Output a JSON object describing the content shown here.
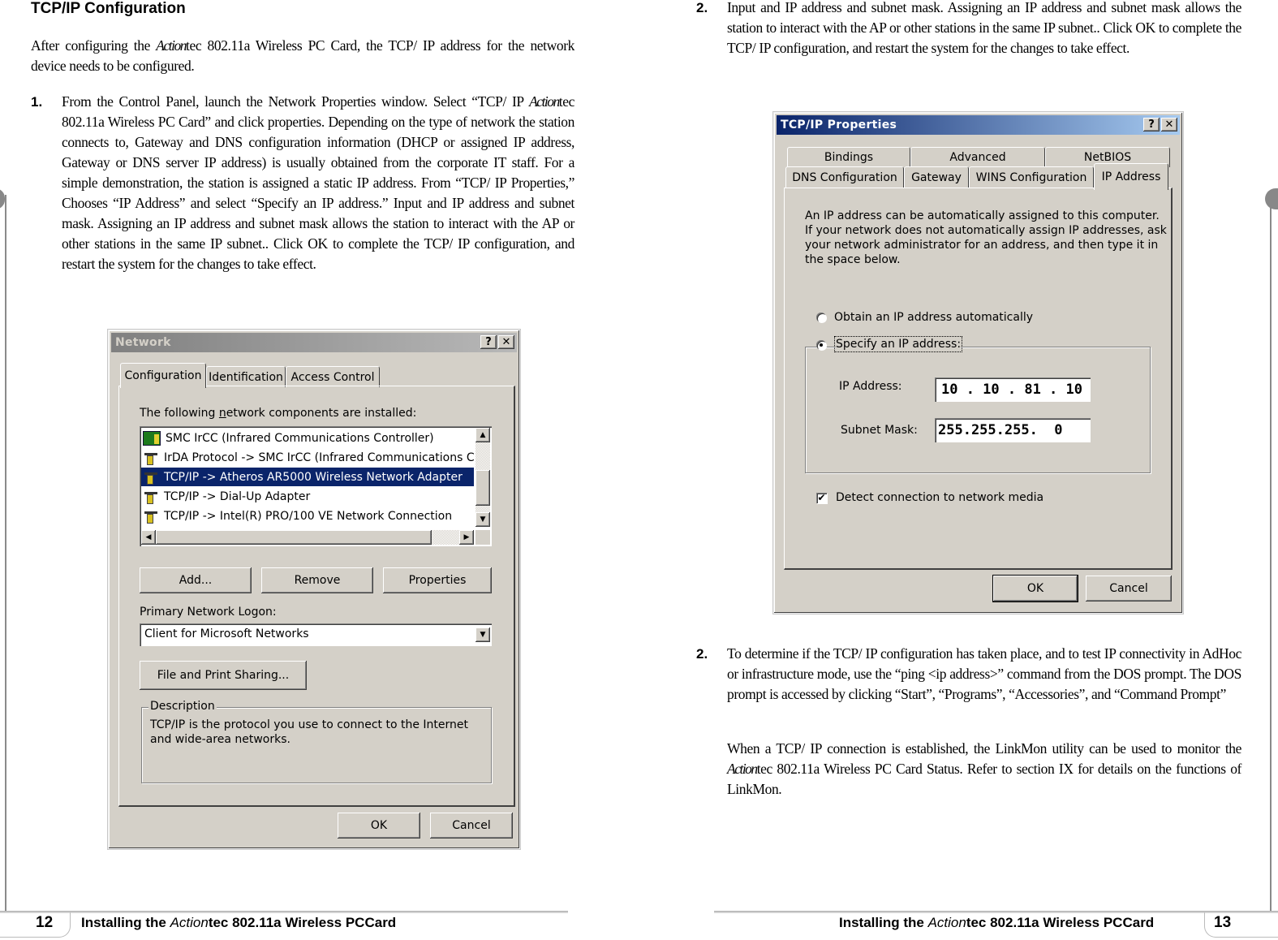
{
  "left_page": {
    "heading": "TCP/IP Configuration",
    "intro_pre": "After configuring the ",
    "brand": "Action",
    "intro_post": "tec 802.11a Wireless PC Card, the TCP/ IP address for the network device needs to be configured.",
    "step1_num": "1.",
    "step1_pre": "From the Control Panel, launch the Network Properties window. Select “TCP/ IP ",
    "step1_post": "tec 802.11a Wireless PC Card” and click properties. Depending on the type of network the station connects to, Gateway and DNS configuration information (DHCP or assigned IP address, Gateway or DNS server IP address) is usually obtained from the corporate IT staff. For a simple demonstration, the station is assigned a static IP address. From “TCP/ IP Properties,” Chooses “IP Address” and select “Specify an IP address.” Input and IP address and subnet mask. Assigning an IP address and subnet mask allows the station to interact with the AP or other stations in the same IP subnet.. Click OK to complete the TCP/ IP configuration, and restart the system for the changes to take effect.",
    "page_number": "12",
    "footer_pre": "Installing the ",
    "footer_brand": "Action",
    "footer_post": "tec 802.11a Wireless PCCard"
  },
  "network_dialog": {
    "title": "Network",
    "help_label": "?",
    "close_label": "✕",
    "tabs": [
      {
        "label": "Configuration",
        "active": true
      },
      {
        "label": "Identification",
        "active": false
      },
      {
        "label": "Access Control",
        "active": false
      }
    ],
    "components_label_pre": "The following ",
    "components_label_accel": "n",
    "components_label_post": "etwork components are installed:",
    "components": [
      {
        "label": "SMC IrCC (Infrared Communications Controller)",
        "icon": "network-adapter-icon",
        "selected": false
      },
      {
        "label": "IrDA Protocol -> SMC IrCC (Infrared Communications Controller)",
        "icon": "protocol-icon",
        "selected": false
      },
      {
        "label": "TCP/IP -> Atheros AR5000 Wireless Network Adapter",
        "icon": "protocol-icon",
        "selected": true
      },
      {
        "label": "TCP/IP -> Dial-Up Adapter",
        "icon": "protocol-icon",
        "selected": false
      },
      {
        "label": "TCP/IP -> Intel(R) PRO/100 VE Network Connection",
        "icon": "protocol-icon",
        "selected": false
      }
    ],
    "buttons": {
      "add": "Add...",
      "remove": "Remove",
      "properties": "Properties",
      "file_print": "File and Print Sharing...",
      "ok": "OK",
      "cancel": "Cancel"
    },
    "primary_logon_label": "Primary Network Logon:",
    "primary_logon_value": "Client for Microsoft Networks",
    "description_label": "Description",
    "description_text": "TCP/IP is the protocol you use to connect to the Internet and wide-area networks."
  },
  "right_page": {
    "step2a_num": "2.",
    "step2a_text": "Input and IP address and subnet mask. Assigning an IP address and subnet mask allows the station to interact with  the AP or other stations in the same IP subnet.. Click OK to complete the TCP/ IP configuration, and restart the system for the changes to take effect.",
    "step2b_num": "2.",
    "step2b_text": "To determine if the TCP/ IP configuration has taken place, and to test IP connectivity in AdHoc or infrastructure mode, use the “ping <ip address>” command from the DOS prompt. The DOS prompt is accessed by clicking “Start”,  “Programs”, “Accessories”, and “Command Prompt”",
    "step2c_pre": "When a TCP/ IP connection is established, the LinkMon utility can be used to monitor the ",
    "brand": "Action",
    "step2c_post": "tec 802.11a Wireless PC Card Status. Refer to section IX for details on the functions of LinkMon.",
    "page_number": "13",
    "footer_pre": "Installing the ",
    "footer_brand": "Action",
    "footer_post": "tec 802.11a Wireless PCCard"
  },
  "tcpip_dialog": {
    "title": "TCP/IP Properties",
    "help_label": "?",
    "close_label": "✕",
    "tabs_back": [
      {
        "label": "Bindings"
      },
      {
        "label": "Advanced"
      },
      {
        "label": "NetBIOS"
      }
    ],
    "tabs_front": [
      {
        "label": "DNS Configuration",
        "active": false
      },
      {
        "label": "Gateway",
        "active": false
      },
      {
        "label": "WINS Configuration",
        "active": false
      },
      {
        "label": "IP Address",
        "active": true
      }
    ],
    "info_text": "An IP address can be automatically assigned to this computer. If your network does not automatically assign IP addresses, ask your network administrator for an address, and then type it in the space below.",
    "info_lines": [
      "An IP address can be automatically assigned to this computer.",
      "If your network does not automatically assign IP addresses, ask",
      "your network administrator for an address, and then type it in",
      "the space below."
    ],
    "radio_obtain": {
      "label": "Obtain an IP address automatically",
      "selected": false
    },
    "radio_specify": {
      "label": "Specify an IP address:",
      "selected": true
    },
    "ip_address_label": "IP Address:",
    "ip_address_value": "10 . 10 . 81 . 10",
    "subnet_mask_label": "Subnet Mask:",
    "subnet_mask_value": "255.255.255.  0",
    "detect_checkbox": {
      "label": "Detect connection to network media",
      "checked": true,
      "mark": "✔"
    },
    "ok_label": "OK",
    "cancel_label": "Cancel"
  },
  "colors": {
    "selection": "#0a246a",
    "dialog_face": "#d4d0c8",
    "active_title": "#0a246a",
    "inactive_title": "#808080"
  }
}
